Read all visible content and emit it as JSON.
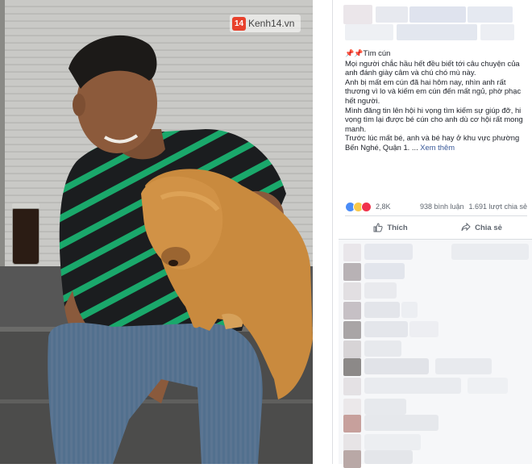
{
  "photo": {
    "watermark": {
      "badge": "14",
      "text": "Kenh14.vn"
    }
  },
  "post": {
    "caption_title": "Tìm cún",
    "caption_paragraphs": [
      "Mọi người chắc hầu hết đều biết tới câu chuyện của anh đánh giày câm và chú chó mù này.",
      "Anh bị mất em cún đã hai hôm nay, nhìn anh rất thương vì lo và kiếm em cún đến mất ngủ, phờ phạc hết người.",
      "Mình đăng tin lên hội hi vọng tìm kiếm sự giúp đỡ, hi vọng tìm lại được bé cún cho anh dù cơ hội rất mong manh.",
      "Trước lúc mất bé, anh và bé hay ở khu vực phường Bến Nghé, Quận 1. ..."
    ],
    "see_more": "Xem thêm",
    "reactions": {
      "count": "2,8K",
      "comments": "938 bình luận",
      "shares": "1.691 lượt chia sẻ"
    },
    "actions": {
      "like": "Thích",
      "share": "Chia sẻ"
    }
  },
  "colors": {
    "facebook_link": "#385898",
    "text": "#1d2129",
    "muted": "#606770",
    "watermark_red": "#e8412c",
    "shirt_green": "#1aa86b"
  }
}
